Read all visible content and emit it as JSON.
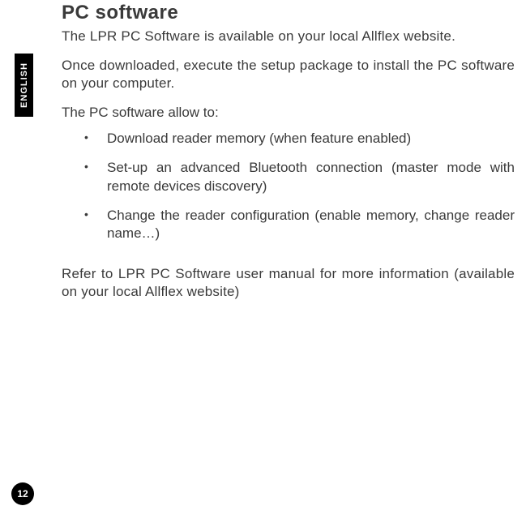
{
  "sideTab": {
    "label": "ENGLISH"
  },
  "title": "PC software",
  "paragraphs": {
    "p1": "The LPR PC Software is available on your local Allflex website.",
    "p2": "Once downloaded, execute the setup package to install the PC software on your computer.",
    "listIntro": "The PC software allow to:",
    "p3": "Refer to LPR PC Software user manual for more information (available on your local Allflex website)"
  },
  "bullets": [
    "Download reader memory (when feature enabled)",
    "Set-up an advanced Bluetooth connection (master mode with remote devices discovery)",
    "Change the reader configuration (enable memory, change reader name…)"
  ],
  "pageNumber": "12"
}
